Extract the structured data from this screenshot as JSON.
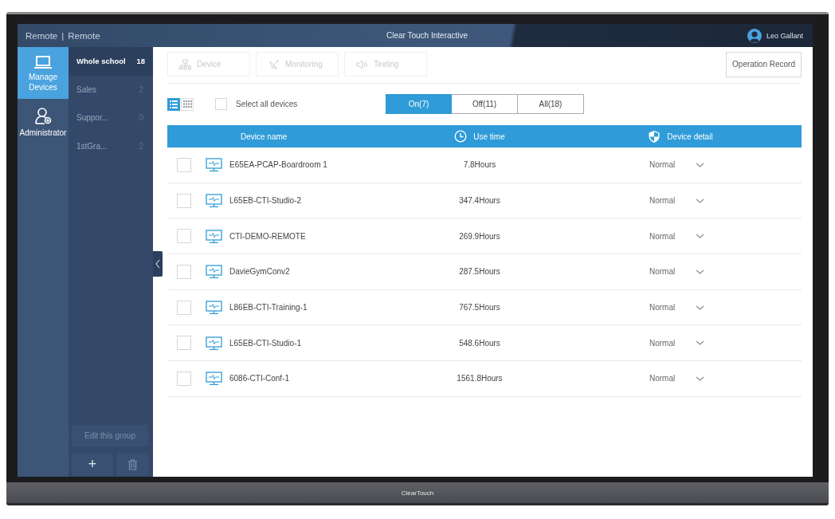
{
  "header": {
    "breadcrumb": [
      "Remote",
      "|",
      "Remote"
    ],
    "title": "Clear Touch Interactive",
    "user": "Leo Gallant"
  },
  "nav": [
    {
      "label": "Manage Devices",
      "selected": true
    },
    {
      "label": "Administrator",
      "selected": false
    }
  ],
  "groups": [
    {
      "name": "Whole school",
      "count": "18",
      "selected": true
    },
    {
      "name": "Sales",
      "count": "2",
      "selected": false
    },
    {
      "name": "Suppor...",
      "count": "0",
      "selected": false
    },
    {
      "name": "1stGra...",
      "count": "2",
      "selected": false
    }
  ],
  "group_actions": {
    "edit": "Edit this group",
    "add": "+"
  },
  "toolbar": {
    "actions": [
      {
        "label": "Device",
        "disabled": true
      },
      {
        "label": "Monitoring",
        "disabled": true
      },
      {
        "label": "Texting",
        "disabled": true
      }
    ],
    "record": "Operation Record"
  },
  "filter": {
    "views": [
      {
        "kind": "list",
        "selected": true
      },
      {
        "kind": "grid",
        "selected": false
      }
    ],
    "select_all": {
      "label": "Select all devices",
      "checked": false
    },
    "segments": [
      {
        "label": "On(7)",
        "selected": true
      },
      {
        "label": "Off(11)",
        "selected": false
      },
      {
        "label": "All(18)",
        "selected": false
      }
    ]
  },
  "table": {
    "columns": [
      {
        "label": "Device name"
      },
      {
        "label": "Use time"
      },
      {
        "label": "Device detail"
      }
    ],
    "rows": [
      {
        "name": "E65EA-PCAP-Boardroom 1",
        "use_time": "7.8Hours",
        "detail": "Normal",
        "checked": false
      },
      {
        "name": "L65EB-CTI-Studio-2",
        "use_time": "347.4Hours",
        "detail": "Normal",
        "checked": false
      },
      {
        "name": "CTI-DEMO-REMOTE",
        "use_time": "269.9Hours",
        "detail": "Normal",
        "checked": false
      },
      {
        "name": "DavieGymConv2",
        "use_time": "287.5Hours",
        "detail": "Normal",
        "checked": false
      },
      {
        "name": "L86EB-CTI-Training-1",
        "use_time": "767.5Hours",
        "detail": "Normal",
        "checked": false
      },
      {
        "name": "L65EB-CTI-Studio-1",
        "use_time": "548.6Hours",
        "detail": "Normal",
        "checked": false
      },
      {
        "name": "6086-CTI-Conf-1",
        "use_time": "1561.8Hours",
        "detail": "Normal",
        "checked": false
      }
    ]
  },
  "bezel": {
    "logo": "ClearTouch"
  }
}
